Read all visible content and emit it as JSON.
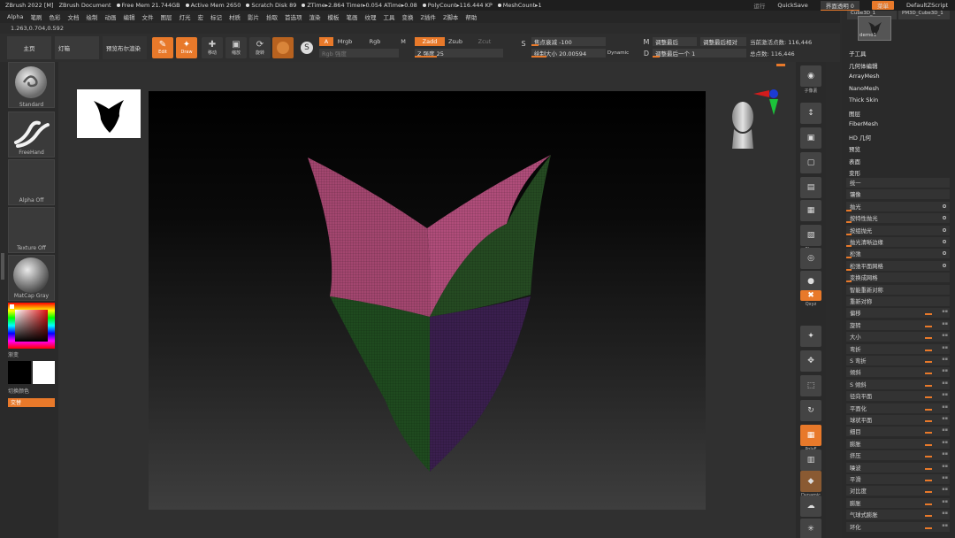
{
  "titlebar": {
    "app": "ZBrush 2022 [M]",
    "document": "ZBrush Document",
    "free_mem": "Free Mem 21.744GB",
    "active_mem": "Active Mem 2650",
    "scratch": "Scratch Disk 89",
    "ztime": "ZTime▸2.864 Timer▸0.054 ATime▸0.08",
    "polycount": "PolyCount▸116.444 KP",
    "meshcount": "MeshCount▸1",
    "right": {
      "hint": "运行",
      "quicksave": "QuickSave",
      "ui_transparency": "界面透明 0",
      "menu": "菜单",
      "script": "DefaultZScript"
    }
  },
  "menubar": [
    "Alpha",
    "笔刷",
    "色彩",
    "文档",
    "绘制",
    "动画",
    "编辑",
    "文件",
    "图层",
    "灯光",
    "宏",
    "标记",
    "材质",
    "影片",
    "拾取",
    "首选项",
    "渲染",
    "模板",
    "笔画",
    "纹理",
    "工具",
    "变换",
    "Z插件",
    "Z脚本",
    "帮助"
  ],
  "coords": "1.263,0.704,0.592",
  "toolbar": {
    "home": "主页",
    "lightbox": "灯箱",
    "preview_bpr": "预览布尔渲染",
    "edit": "Edit",
    "draw": "Draw",
    "move": "移动",
    "scale": "缩放",
    "rotate": "旋转",
    "a": "A",
    "mrgb": "Mrgb",
    "rgb": "Rgb",
    "m": "M",
    "zadd": "Zadd",
    "zsub": "Zsub",
    "zcut": "Zcut",
    "rgb_intensity": "Rgb 强度",
    "z_intensity": "Z 强度 25",
    "focal_shift": "焦点衰减 -100",
    "draw_size": "绘制大小 20.00594",
    "dynamic": "Dynamic",
    "adjust_last": "调整最后",
    "adjust_last_rel": "调整最后相对",
    "adjust_last_one": "调整最后一个 1",
    "active_points": "当前激活点数: 116,446",
    "total_points": "总点数: 116,446"
  },
  "leftshelf": {
    "standard": "Standard",
    "freehand": "FreeHand",
    "alpha_off": "Alpha Off",
    "texture_off": "Texture Off",
    "matcap": "MatCap Gray",
    "gradient": "渐变",
    "switch_color": "切换颜色",
    "alternate": "交替"
  },
  "rightcol": {
    "subtool_label": "子像素",
    "floor": "Floor",
    "xyz": "Qxyz",
    "polyf": "PolyF",
    "transp": "Transp",
    "dynamic": "Dynamic",
    "xpose": "Xpose"
  },
  "rightpanel": {
    "subtool_names": [
      "Cube3D_1",
      "PM3D_Cube3D_1"
    ],
    "demo_name": "demo1",
    "headers": [
      "子工具",
      "几何体编辑",
      "ArrayMesh",
      "NanoMesh",
      "Thick Skin",
      "图层",
      "FiberMesh",
      "HD 几何",
      "预览",
      "表面",
      "变形"
    ],
    "rows": [
      "统一",
      "镶像",
      "抛光",
      "按特性抛光",
      "按组抛光",
      "抛光清晰边缘",
      "松弛",
      "松弛平面网格",
      "变换成网格",
      "智能重新对称",
      "重新对称",
      "偏移",
      "旋转",
      "大小",
      "弯折",
      "S 弯折",
      "倾斜",
      "S 倾斜",
      "径向平面",
      "平面化",
      "球状平面",
      "细目",
      "膨胀",
      "挤压",
      "噪波",
      "平滑",
      "对比度",
      "膨胀",
      "气球式膨胀",
      "环化"
    ]
  }
}
